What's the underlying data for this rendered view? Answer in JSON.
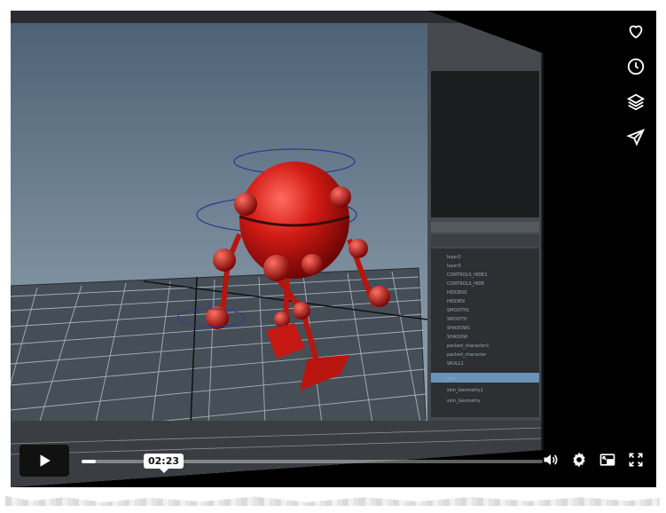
{
  "player": {
    "current_time": "02:23",
    "progress_fraction": 0.03
  },
  "side_actions": [
    {
      "name": "like-icon"
    },
    {
      "name": "watch-later-icon"
    },
    {
      "name": "collections-icon"
    },
    {
      "name": "share-icon"
    }
  ],
  "controls": {
    "play_icon": "play-icon",
    "volume_icon": "volume-icon",
    "settings_icon": "gear-icon",
    "pip_icon": "picture-in-picture-icon",
    "fullscreen_icon": "fullscreen-icon"
  },
  "colors": {
    "player_bg": "#000000",
    "robot_red": "#c81414",
    "viewport_bg": "#5d7184"
  }
}
